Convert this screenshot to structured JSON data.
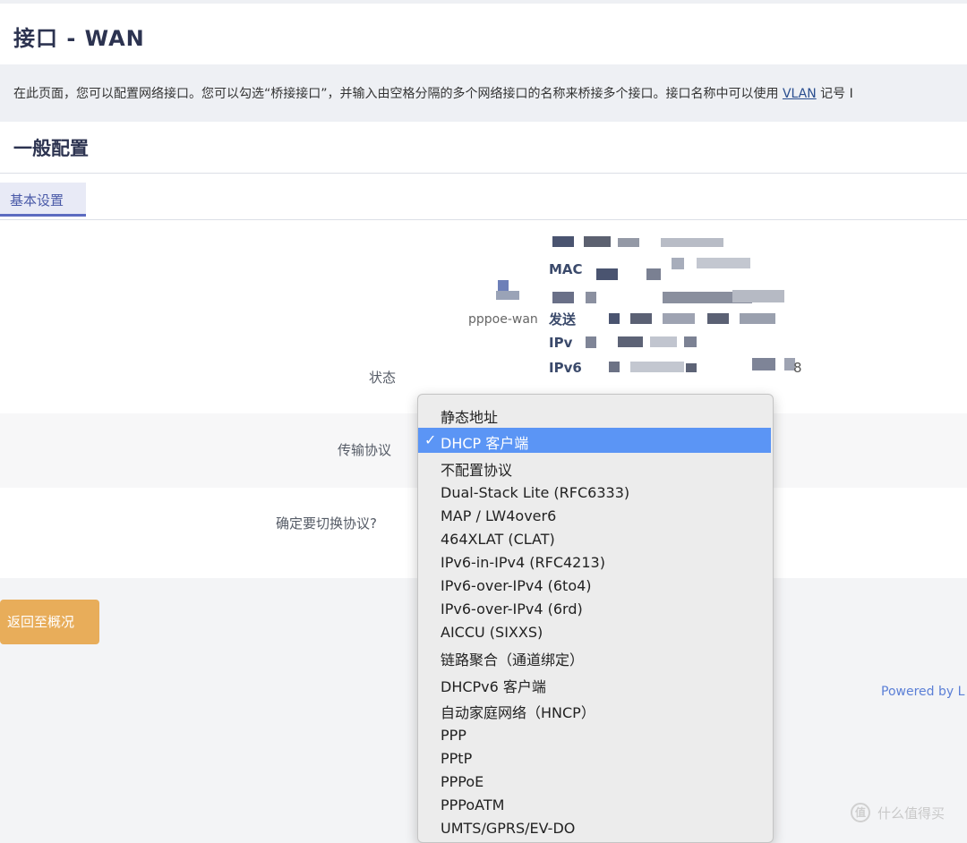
{
  "header": {
    "title": "接口 - WAN"
  },
  "description": {
    "text_before": "在此页面，您可以配置网络接口。您可以勾选“桥接接口”，并输入由空格分隔的多个网络接口的名称来桥接多个接口。接口名称中可以使用 ",
    "link": "VLAN",
    "text_after": " 记号 I"
  },
  "section": {
    "title": "一般配置"
  },
  "tabs": [
    {
      "label": "基本设置"
    }
  ],
  "status": {
    "label": "状态",
    "interface_name": "pppoe-wan",
    "visible_fragments": [
      "MAC",
      "发送",
      "IPv",
      "IPv6",
      "8"
    ]
  },
  "protocol": {
    "label": "传输协议",
    "selected": "DHCP 客户端",
    "check_mark": "✓",
    "options": [
      "静态地址",
      "DHCP 客户端",
      "不配置协议",
      "Dual-Stack Lite (RFC6333)",
      "MAP / LW4over6",
      "464XLAT (CLAT)",
      "IPv6-in-IPv4 (RFC4213)",
      "IPv6-over-IPv4 (6to4)",
      "IPv6-over-IPv4 (6rd)",
      "AICCU (SIXXS)",
      "链路聚合（通道绑定）",
      "DHCPv6 客户端",
      "自动家庭网络（HNCP）",
      "PPP",
      "PPtP",
      "PPPoE",
      "PPPoATM",
      "UMTS/GPRS/EV-DO"
    ]
  },
  "confirm": {
    "label": "确定要切换协议?"
  },
  "actions": {
    "back_label": "返回至概况"
  },
  "footer": {
    "powered_by": "Powered by L"
  },
  "watermark": {
    "icon_glyph": "值",
    "text": "什么值得买"
  },
  "colors": {
    "accent": "#5c6bc0",
    "back_button": "#e8ad5a",
    "selected_option": "#5b95f5",
    "link": "#5b7fd6"
  }
}
